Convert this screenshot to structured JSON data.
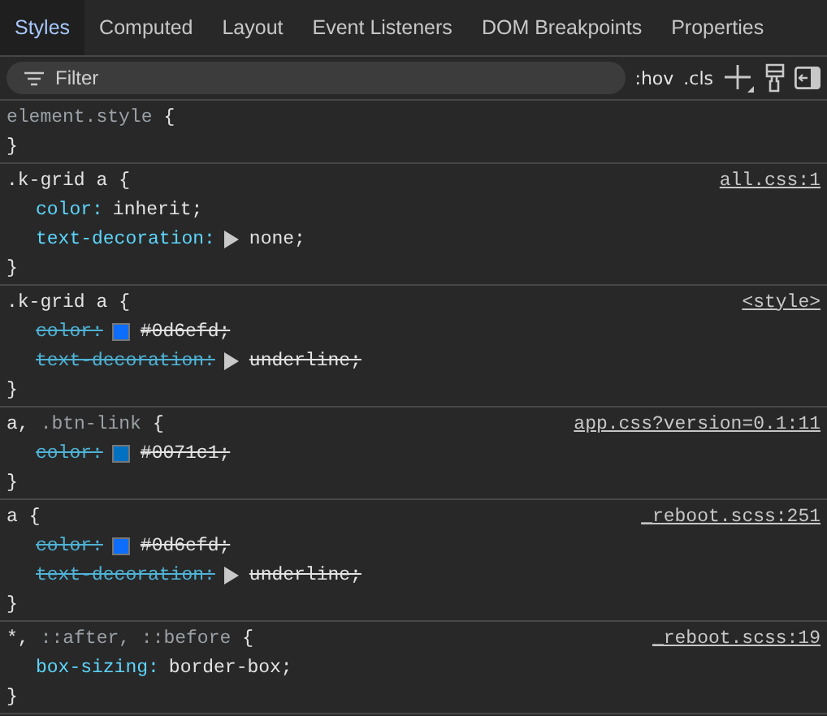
{
  "tabs": [
    {
      "label": "Styles",
      "selected": true
    },
    {
      "label": "Computed",
      "selected": false
    },
    {
      "label": "Layout",
      "selected": false
    },
    {
      "label": "Event Listeners",
      "selected": false
    },
    {
      "label": "DOM Breakpoints",
      "selected": false
    },
    {
      "label": "Properties",
      "selected": false
    }
  ],
  "filter": {
    "placeholder": "Filter",
    "toggles": [
      ":hov",
      ".cls"
    ]
  },
  "rules": [
    {
      "selector_parts": [
        {
          "text": "element.style",
          "matched": false
        }
      ],
      "open_brace": "{",
      "close_brace": "}"
    },
    {
      "selector_parts": [
        {
          "text": ".k-grid a",
          "matched": true
        }
      ],
      "open_brace": "{",
      "close_brace": "}",
      "source": "all.css:1",
      "declarations": [
        {
          "kind": "plain",
          "property": "color:",
          "value": "inherit;",
          "overridden": false
        },
        {
          "kind": "shorthand",
          "property": "text-decoration:",
          "value": "none;",
          "overridden": false
        }
      ]
    },
    {
      "selector_parts": [
        {
          "text": ".k-grid a",
          "matched": true
        }
      ],
      "open_brace": "{",
      "close_brace": "}",
      "source": "<style>",
      "declarations": [
        {
          "kind": "swatch",
          "property": "color:",
          "value": "#0d6efd;",
          "color": "#0d6efd",
          "overridden": true
        },
        {
          "kind": "shorthand",
          "property": "text-decoration:",
          "value": "underline;",
          "overridden": true
        }
      ]
    },
    {
      "selector_parts": [
        {
          "text": "a,",
          "matched": true
        },
        {
          "text": ".btn-link",
          "matched": false
        }
      ],
      "open_brace": "{",
      "close_brace": "}",
      "source": "app.css?version=0.1:11",
      "declarations": [
        {
          "kind": "swatch",
          "property": "color:",
          "value": "#0071c1;",
          "color": "#0071c1",
          "overridden": true
        }
      ]
    },
    {
      "selector_parts": [
        {
          "text": "a",
          "matched": true
        }
      ],
      "open_brace": "{",
      "close_brace": "}",
      "source": "_reboot.scss:251",
      "declarations": [
        {
          "kind": "swatch",
          "property": "color:",
          "value": "#0d6efd;",
          "color": "#0d6efd",
          "overridden": true
        },
        {
          "kind": "shorthand",
          "property": "text-decoration:",
          "value": "underline;",
          "overridden": true
        }
      ]
    },
    {
      "selector_parts": [
        {
          "text": "*,",
          "matched": true
        },
        {
          "text": "::after, ::before",
          "matched": false
        }
      ],
      "open_brace": "{",
      "close_brace": "}",
      "source": "_reboot.scss:19",
      "declarations": [
        {
          "kind": "plain",
          "property": "box-sizing:",
          "value": "border-box;",
          "overridden": false
        }
      ]
    }
  ]
}
